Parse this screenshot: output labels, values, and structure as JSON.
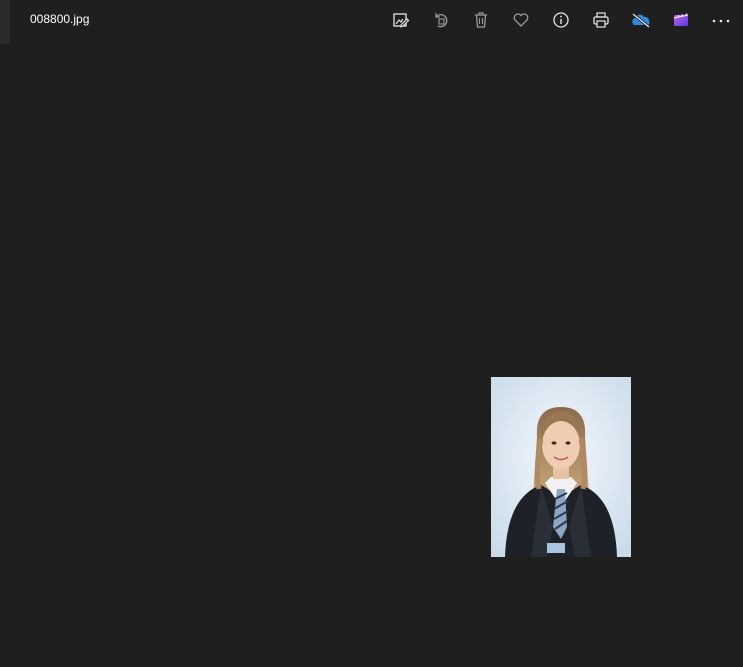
{
  "window": {
    "title": "008800.jpg"
  },
  "toolbar": {
    "buttons": [
      {
        "icon": "edit-image-icon"
      },
      {
        "icon": "rotate-icon"
      },
      {
        "icon": "delete-icon"
      },
      {
        "icon": "favorite-icon"
      },
      {
        "icon": "info-icon"
      },
      {
        "icon": "print-icon"
      },
      {
        "icon": "onedrive-icon"
      },
      {
        "icon": "video-editor-icon"
      },
      {
        "icon": "more-icon"
      }
    ]
  },
  "colors": {
    "background": "#1f1f1f",
    "icon": "#e6e6e6",
    "icon_dim": "#9a9a9a",
    "onedrive": "#2e8ae6",
    "video_editor": "#8c4de6"
  }
}
